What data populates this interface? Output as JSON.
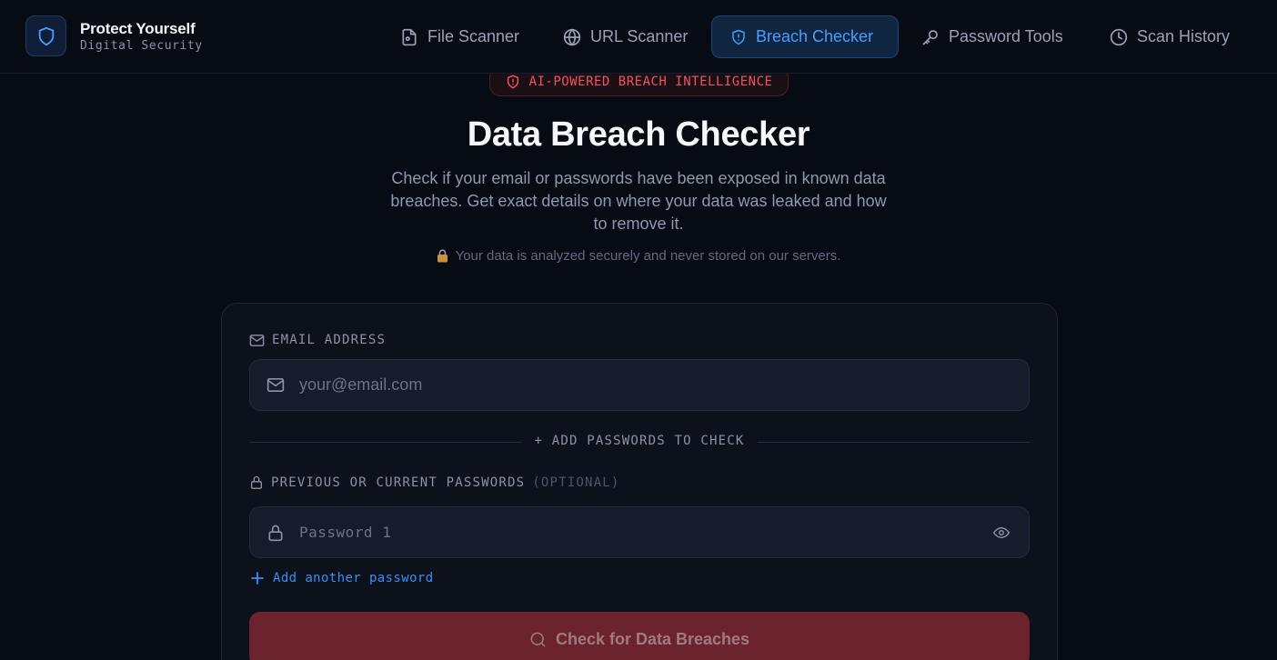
{
  "brand": {
    "title": "Protect Yourself",
    "subtitle": "Digital Security",
    "icon": "shield-icon"
  },
  "nav": [
    {
      "label": "File Scanner",
      "icon": "file-icon",
      "active": false
    },
    {
      "label": "URL Scanner",
      "icon": "globe-icon",
      "active": false
    },
    {
      "label": "Breach Checker",
      "icon": "shield-icon",
      "active": true
    },
    {
      "label": "Password Tools",
      "icon": "key-icon",
      "active": false
    },
    {
      "label": "Scan History",
      "icon": "clock-icon",
      "active": false
    }
  ],
  "badge": {
    "label": "AI-POWERED BREACH INTELLIGENCE",
    "icon": "shield-alert-icon"
  },
  "hero": {
    "title": "Data Breach Checker",
    "description": "Check if your email or passwords have been exposed in known data breaches. Get exact details on where your data was leaked and how to remove it.",
    "secure_note": "Your data is analyzed securely and never stored on our servers."
  },
  "form": {
    "email_label": "EMAIL ADDRESS",
    "email_placeholder": "your@email.com",
    "divider_label": "+ ADD PASSWORDS TO CHECK",
    "passwords_label": "PREVIOUS OR CURRENT PASSWORDS",
    "passwords_optional": "(OPTIONAL)",
    "password_placeholder": "Password 1",
    "add_password_label": "Add another password",
    "submit_label": "Check for Data Breaches"
  },
  "colors": {
    "accent": "#4a9dff",
    "danger": "#f0525f",
    "submit_bg": "#6b232d",
    "background": "#070b14"
  }
}
